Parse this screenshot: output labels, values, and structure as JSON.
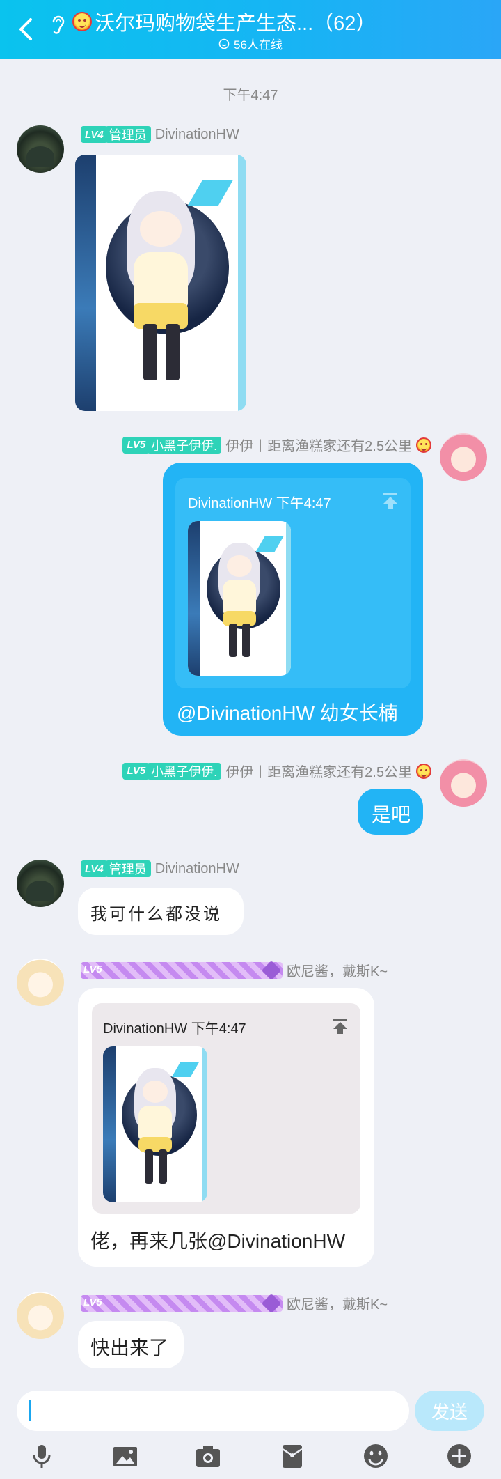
{
  "header": {
    "title": "沃尔玛购物袋生产生态...（62）",
    "online": "56人在线"
  },
  "time_separator": "下午4:47",
  "messages": {
    "m1": {
      "level": "LV4",
      "title": "管理员",
      "name": "DivinationHW"
    },
    "m2": {
      "level": "LV5",
      "title": "小黑子伊伊.",
      "name": "伊伊丨距离渔糕家还有2.5公里",
      "quote_head": "DivinationHW 下午4:47",
      "text": "@DivinationHW 幼女长楠"
    },
    "m3": {
      "level": "LV5",
      "title": "小黑子伊伊.",
      "name": "伊伊丨距离渔糕家还有2.5公里",
      "text": "是吧"
    },
    "m4": {
      "level": "LV4",
      "title": "管理员",
      "name": "DivinationHW",
      "text": "我可什么都没说"
    },
    "m5": {
      "level": "LV5",
      "name": "欧尼酱，戴斯K~",
      "quote_head": "DivinationHW 下午4:47",
      "text": "佬，再来几张@DivinationHW"
    },
    "m6": {
      "level": "LV5",
      "name": "欧尼酱，戴斯K~",
      "text": "快出来了"
    }
  },
  "input": {
    "placeholder": "",
    "send_label": "发送"
  },
  "toolbar": {
    "icons": [
      "microphone-icon",
      "image-icon",
      "camera-icon",
      "red-packet-icon",
      "emoji-icon",
      "plus-icon"
    ]
  },
  "colors": {
    "header": "#16b5f4",
    "my_bubble": "#22b4f5",
    "level_tag": "#2ed3b8",
    "purple_tag": "#c58af0"
  }
}
